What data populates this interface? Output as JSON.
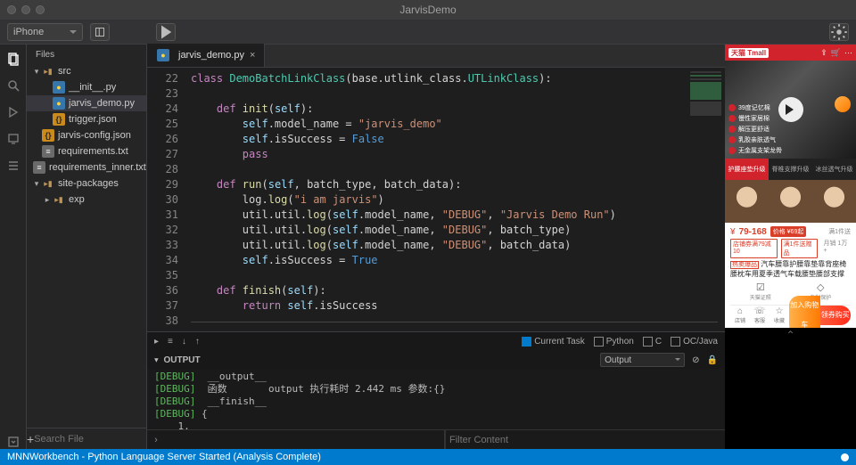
{
  "window": {
    "title": "JarvisDemo"
  },
  "toolbar": {
    "device": "iPhone"
  },
  "sidebar": {
    "header": "Files",
    "tree": [
      {
        "label": "src",
        "kind": "folder",
        "depth": 0,
        "open": true
      },
      {
        "label": "__init__.py",
        "kind": "py",
        "depth": 1
      },
      {
        "label": "jarvis_demo.py",
        "kind": "py",
        "depth": 1,
        "selected": true
      },
      {
        "label": "trigger.json",
        "kind": "js",
        "depth": 1
      },
      {
        "label": "jarvis-config.json",
        "kind": "js",
        "depth": 0
      },
      {
        "label": "requirements.txt",
        "kind": "txt",
        "depth": 0
      },
      {
        "label": "requirements_inner.txt",
        "kind": "txt",
        "depth": 0
      },
      {
        "label": "site-packages",
        "kind": "folder",
        "depth": 0,
        "open": true
      },
      {
        "label": "exp",
        "kind": "folder",
        "depth": 1,
        "open": false
      }
    ],
    "search_placeholder": "Search File"
  },
  "tabs": {
    "active": "jarvis_demo.py"
  },
  "code": {
    "first_line": 22,
    "lines": [
      {
        "t": "class DemoBatchLinkClass(base.utlink_class.UTLinkClass):",
        "h": [
          [
            "class ",
            "kw"
          ],
          [
            "DemoBatchLinkClass",
            "cls"
          ],
          [
            "(base.utlink_class.",
            ""
          ],
          [
            "UTLinkClass",
            "cls"
          ],
          [
            "):",
            ""
          ]
        ]
      },
      {
        "t": ""
      },
      {
        "t": "    def init(self):",
        "h": [
          [
            "    def ",
            "kw"
          ],
          [
            "init",
            "fn"
          ],
          [
            "(",
            ""
          ],
          [
            "self",
            "sf"
          ],
          [
            "):",
            ""
          ]
        ]
      },
      {
        "t": "        self.model_name = \"jarvis_demo\"",
        "h": [
          [
            "        ",
            ""
          ],
          [
            "self",
            "sf"
          ],
          [
            ".model_name = ",
            ""
          ],
          [
            "\"jarvis_demo\"",
            "s"
          ]
        ]
      },
      {
        "t": "        self.isSuccess = False",
        "h": [
          [
            "        ",
            ""
          ],
          [
            "self",
            "sf"
          ],
          [
            ".isSuccess = ",
            ""
          ],
          [
            "False",
            "bl"
          ]
        ]
      },
      {
        "t": "        pass",
        "h": [
          [
            "        ",
            ""
          ],
          [
            "pass",
            "kw"
          ]
        ]
      },
      {
        "t": ""
      },
      {
        "t": "    def run(self, batch_type, batch_data):",
        "h": [
          [
            "    def ",
            "kw"
          ],
          [
            "run",
            "fn"
          ],
          [
            "(",
            ""
          ],
          [
            "self",
            "sf"
          ],
          [
            ", batch_type, batch_data):",
            ""
          ]
        ]
      },
      {
        "t": "        log.log(\"i am jarvis\")",
        "h": [
          [
            "        log.",
            ""
          ],
          [
            "log",
            "fn"
          ],
          [
            "(",
            ""
          ],
          [
            "\"i am jarvis\"",
            "s"
          ],
          [
            ")",
            ""
          ]
        ]
      },
      {
        "t": "        util.util.log(self.model_name, \"DEBUG\", \"Jarvis Demo Run\")",
        "h": [
          [
            "        util.util.",
            ""
          ],
          [
            "log",
            "fn"
          ],
          [
            "(",
            ""
          ],
          [
            "self",
            "sf"
          ],
          [
            ".model_name, ",
            ""
          ],
          [
            "\"DEBUG\"",
            "s"
          ],
          [
            ", ",
            ""
          ],
          [
            "\"Jarvis Demo Run\"",
            "s"
          ],
          [
            ")",
            ""
          ]
        ]
      },
      {
        "t": "        util.util.log(self.model_name, \"DEBUG\", batch_type)",
        "h": [
          [
            "        util.util.",
            ""
          ],
          [
            "log",
            "fn"
          ],
          [
            "(",
            ""
          ],
          [
            "self",
            "sf"
          ],
          [
            ".model_name, ",
            ""
          ],
          [
            "\"DEBUG\"",
            "s"
          ],
          [
            ", batch_type)",
            ""
          ]
        ]
      },
      {
        "t": "        util.util.log(self.model_name, \"DEBUG\", batch_data)",
        "h": [
          [
            "        util.util.",
            ""
          ],
          [
            "log",
            "fn"
          ],
          [
            "(",
            ""
          ],
          [
            "self",
            "sf"
          ],
          [
            ".model_name, ",
            ""
          ],
          [
            "\"DEBUG\"",
            "s"
          ],
          [
            ", batch_data)",
            ""
          ]
        ]
      },
      {
        "t": "        self.isSuccess = True",
        "h": [
          [
            "        ",
            ""
          ],
          [
            "self",
            "sf"
          ],
          [
            ".isSuccess = ",
            ""
          ],
          [
            "True",
            "bl"
          ]
        ]
      },
      {
        "t": ""
      },
      {
        "t": "    def finish(self):",
        "h": [
          [
            "    def ",
            "kw"
          ],
          [
            "finish",
            "fn"
          ],
          [
            "(",
            ""
          ],
          [
            "self",
            "sf"
          ],
          [
            "):",
            ""
          ]
        ]
      },
      {
        "t": "        return self.isSuccess",
        "h": [
          [
            "        ",
            ""
          ],
          [
            "return ",
            "kw"
          ],
          [
            "self",
            "sf"
          ],
          [
            ".isSuccess",
            ""
          ]
        ]
      },
      {
        "t": "",
        "rule": true
      },
      {
        "t": ""
      },
      {
        "t": ""
      }
    ]
  },
  "consolebar": {
    "current_task": "Current Task",
    "langs": [
      "Python",
      "C",
      "OC/Java"
    ]
  },
  "output": {
    "label": "OUTPUT",
    "selector": "Output",
    "filter_placeholder": "Filter Content",
    "lines": [
      "[DEBUG]  __output__",
      "[DEBUG]  函数       output 执行耗时 2.442 ms 参数:{}",
      "[DEBUG]  __finish__",
      "[DEBUG] {",
      "    1,",
      "    \"\"",
      "}"
    ]
  },
  "status": {
    "text": "MNNWorkbench - Python Language Server Started (Analysis Complete)"
  },
  "phone": {
    "header": {
      "brand": "天猫 Tmall"
    },
    "bullets": [
      "39度记忆棉",
      "慢性家居棉",
      "解压更舒适",
      "乳胶亲肤透气",
      "无金属支架龙骨"
    ],
    "feature_tabs": [
      {
        "label": "护腰座垫升级",
        "selected": true
      },
      {
        "label": "脊椎支撑升级",
        "selected": false
      },
      {
        "label": "冰丝透气升级",
        "selected": false
      }
    ],
    "price": {
      "symbol": "¥",
      "range": "79-168",
      "original": "¥69起",
      "badge": "价格",
      "ship_label": "满1件送"
    },
    "coupons": [
      "店铺券满79减10",
      "满1件送赠品"
    ],
    "sales": "月销 1万+",
    "title_tag": "热卖爆品",
    "title": "汽车腰靠护腰靠垫靠背座椅腰枕车用夏季透气车载腰垫腰部支撑头枕",
    "trust": [
      {
        "icon": "☑",
        "l1": "天猫证照",
        "l2": ""
      },
      {
        "icon": "◇",
        "l1": "专利保护",
        "l2": ""
      }
    ],
    "nav": {
      "icons": [
        {
          "g": "⌂",
          "label": "店铺"
        },
        {
          "g": "☏",
          "label": "客服"
        },
        {
          "g": "☆",
          "label": "收藏"
        }
      ],
      "cart": "加入购物车",
      "buy": "领券购买"
    }
  }
}
